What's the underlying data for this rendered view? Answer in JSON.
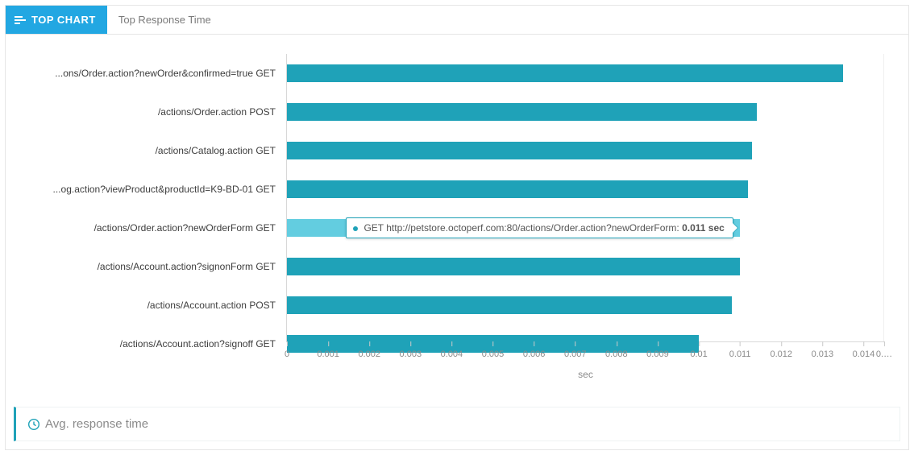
{
  "header": {
    "badge_label": "TOP CHART",
    "title": "Top Response Time"
  },
  "chart_data": {
    "type": "bar",
    "orientation": "horizontal",
    "xlabel": "sec",
    "ylabel": "",
    "xlim": [
      0,
      0.0145
    ],
    "ylim": null,
    "categories": [
      "...ons/Order.action?newOrder&confirmed=true GET",
      "/actions/Order.action POST",
      "/actions/Catalog.action GET",
      "...og.action?viewProduct&productId=K9-BD-01 GET",
      "/actions/Order.action?newOrderForm GET",
      "/actions/Account.action?signonForm GET",
      "/actions/Account.action POST",
      "/actions/Account.action?signoff GET"
    ],
    "values": [
      0.0135,
      0.0114,
      0.0113,
      0.0112,
      0.011,
      0.011,
      0.0108,
      0.01
    ],
    "highlight_index": 4,
    "ticks": [
      0,
      0.001,
      0.002,
      0.003,
      0.004,
      0.005,
      0.006,
      0.007,
      0.008,
      0.009,
      0.01,
      0.011,
      0.012,
      0.013,
      0.014
    ],
    "tick_overflow_label": "0.…"
  },
  "tooltip": {
    "text_prefix": "GET http://petstore.octoperf.com:80/actions/Order.action?newOrderForm: ",
    "value_bold": "0.011 sec"
  },
  "legend": {
    "label": "Avg. response time"
  },
  "colors": {
    "primary": "#1fa2b8",
    "header_blue": "#22a7e2",
    "bar_highlight": "#63cde0"
  }
}
